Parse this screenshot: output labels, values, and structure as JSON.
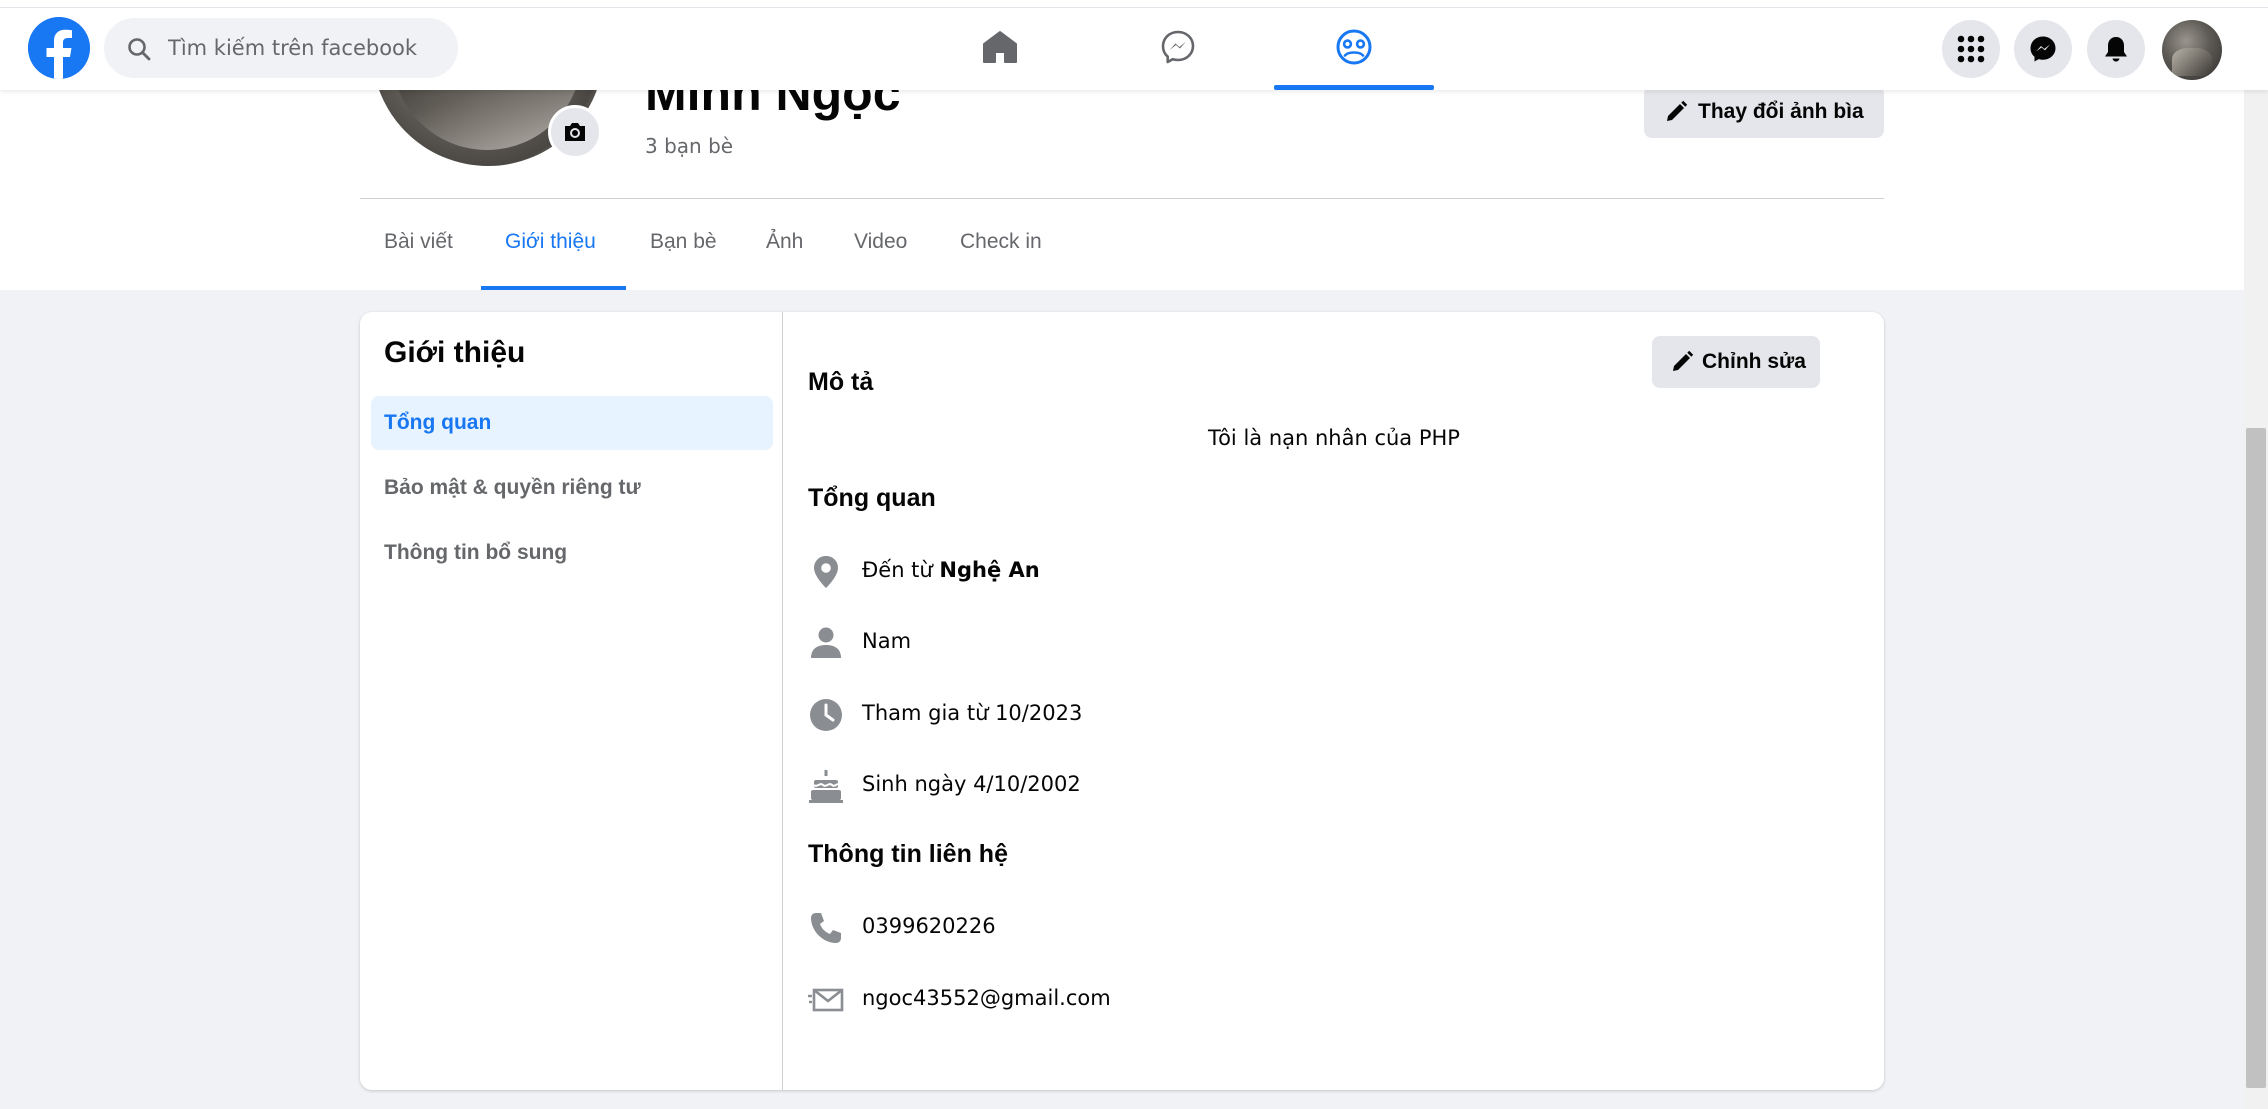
{
  "topbar": {
    "search_placeholder": "Tìm kiếm trên facebook",
    "nav_tabs": [
      "home",
      "messenger",
      "groups"
    ],
    "active_tab": "groups",
    "accent": "#1877f2"
  },
  "profile": {
    "name": "Minh Ngọc",
    "friend_count": "3 bạn bè",
    "cover_button": "Thay đổi ảnh bìa",
    "tabs": [
      {
        "label": "Bài viết"
      },
      {
        "label": "Giới thiệu"
      },
      {
        "label": "Bạn bè"
      },
      {
        "label": "Ảnh"
      },
      {
        "label": "Video"
      },
      {
        "label": "Check in"
      }
    ],
    "active_tab": "Giới thiệu"
  },
  "intro": {
    "title": "Giới thiệu",
    "menu": [
      {
        "label": "Tổng quan"
      },
      {
        "label": "Bảo mật & quyền riêng tư"
      },
      {
        "label": "Thông tin bổ sung"
      }
    ],
    "active_menu": "Tổng quan",
    "edit_button": "Chỉnh sửa",
    "description_title": "Mô tả",
    "description": "Tôi là nạn nhân của PHP",
    "overview_title": "Tổng quan",
    "overview": {
      "hometown_prefix": "Đến từ",
      "hometown": "Nghệ An",
      "gender": "Nam",
      "joined": "Tham gia từ 10/2023",
      "birthday": "Sinh ngày 4/10/2002"
    },
    "contact_title": "Thông tin liên hệ",
    "contact": {
      "phone": "0399620226",
      "email": "ngoc43552@gmail.com"
    }
  },
  "icons": {
    "location": "location-pin-icon",
    "gender": "person-icon",
    "joined": "clock-icon",
    "birthday": "cake-icon",
    "phone": "phone-icon",
    "email": "mail-icon"
  }
}
